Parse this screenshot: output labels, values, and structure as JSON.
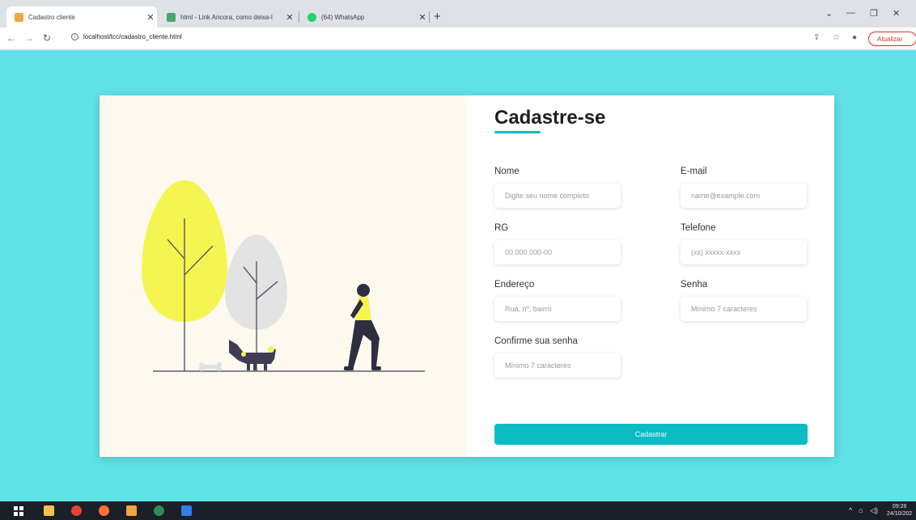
{
  "browser": {
    "tabs": [
      {
        "title": "Cadastro cliente",
        "favicon_color": "#f3a63a"
      },
      {
        "title": "html - Link Ancora, como deixa-l",
        "favicon_color": "#48a868"
      },
      {
        "title": "(64) WhatsApp",
        "favicon_color": "#25d366"
      }
    ],
    "url": "localhost/tcc/cadastro_cliente.html",
    "update_label": "Atualizar"
  },
  "page": {
    "background": "#5fe1e6",
    "accent": "#0bbcc4"
  },
  "form": {
    "title": "Cadastre-se",
    "fields": {
      "nome": {
        "label": "Nome",
        "placeholder": "Digite seu nome completo"
      },
      "email": {
        "label": "E-mail",
        "placeholder": "name@example.com"
      },
      "rg": {
        "label": "RG",
        "placeholder": "00.000.000-00"
      },
      "telefone": {
        "label": "Telefone",
        "placeholder": "(xx) xxxxx-xxxx"
      },
      "endereco": {
        "label": "Endereço",
        "placeholder": "Rua, nº, bairro"
      },
      "senha": {
        "label": "Senha",
        "placeholder": "Mínimo 7 caracteres"
      },
      "confirme": {
        "label": "Confirme sua senha",
        "placeholder": "Mínimo 7 caracteres"
      }
    },
    "submit_label": "Cadastrar"
  },
  "taskbar": {
    "time": "09:28",
    "date": "24/10/202"
  }
}
